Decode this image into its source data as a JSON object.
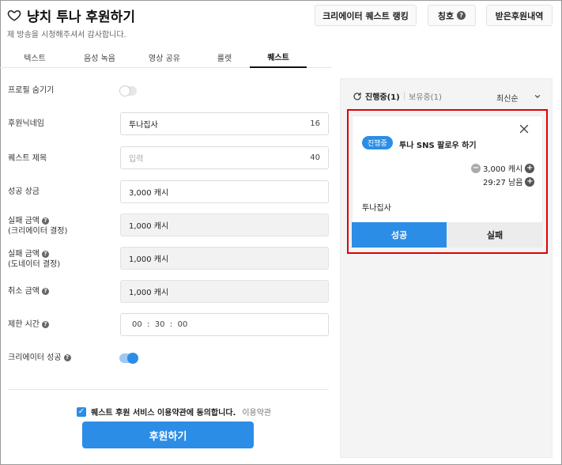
{
  "header": {
    "title": "냥치 투나 후원하기",
    "subtitle": "제 방송을 시청해주셔서 감사합니다.",
    "buttons": {
      "ranking": "크리에이터 퀘스트 랭킹",
      "title_badge": "칭호",
      "received": "받은후원내역"
    },
    "help_glyph": "?"
  },
  "tabs": [
    {
      "label": "텍스트",
      "active": false
    },
    {
      "label": "음성 녹음",
      "active": false
    },
    {
      "label": "영상 공유",
      "active": false
    },
    {
      "label": "룰렛",
      "active": false
    },
    {
      "label": "퀘스트",
      "active": true
    }
  ],
  "form": {
    "hide_profile": {
      "label": "프로필 숨기기",
      "on": false
    },
    "nickname": {
      "label": "후원닉네임",
      "value": "투나집사",
      "count": "16"
    },
    "quest_title": {
      "label": "퀘스트 제목",
      "placeholder": "입력",
      "count": "40"
    },
    "success_reward": {
      "label": "성공 상금",
      "value": "3,000 캐시"
    },
    "fail_creator": {
      "label_line1": "실패 금액",
      "label_line2": "(크리에이터 결정)",
      "value": "1,000 캐시"
    },
    "fail_donor": {
      "label_line1": "실패 금액",
      "label_line2": "(도네이터 결정)",
      "value": "1,000 캐시"
    },
    "cancel_amount": {
      "label": "취소 금액",
      "value": "1,000 캐시"
    },
    "time_limit": {
      "label": "제한 시간",
      "value": "00  :  30  :  00"
    },
    "creator_success": {
      "label": "크리에이터 성공",
      "on": true
    },
    "agree": {
      "text": "퀘스트 후원 서비스 이용약관에 동의합니다.",
      "link": "이용약관",
      "checked": true,
      "check_glyph": "✓"
    },
    "submit": "후원하기"
  },
  "quest_panel": {
    "tab_active": "진행중(1)",
    "divider": "|",
    "tab_inactive": "보유중(1)",
    "sort": "최신순",
    "card": {
      "badge": "진행중",
      "title": "투나 SNS 팔로우 하기",
      "amount": "3,000 캐시",
      "time": "29:27 남음",
      "minus_glyph": "−",
      "plus_glyph": "+",
      "donor": "투나집사",
      "success_btn": "성공",
      "fail_btn": "실패"
    }
  },
  "colors": {
    "accent": "#2b8de6",
    "highlight_border": "#e00000"
  },
  "icons": [
    "heart-icon",
    "help-icon",
    "refresh-icon",
    "chevron-down-icon",
    "close-icon",
    "minus-circle-icon",
    "plus-circle-icon",
    "checkbox-checked-icon"
  ]
}
